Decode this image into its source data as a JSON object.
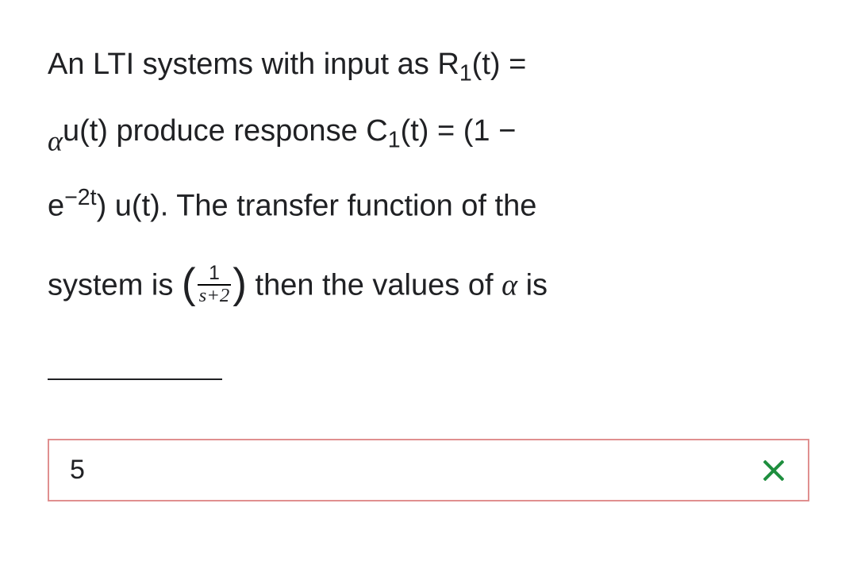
{
  "question": {
    "p1a": "An LTI systems with input as R",
    "p1sub": "1",
    "p1b": "(t) = ",
    "alpha1": "α",
    "p2a": "u(t) produce response C",
    "p2sub": "1",
    "p2b": "(t) = (1 − ",
    "p3a": "e",
    "p3sup": "−2t",
    "p3b": ") u(t). The transfer function of the ",
    "p4a": "system is ",
    "lparen": "(",
    "fracnum": "1",
    "fracden": "s+2",
    "rparen": ")",
    "p4b": " then the values of ",
    "alpha2": "α",
    "p4c": " is"
  },
  "answer": {
    "value": "5"
  }
}
